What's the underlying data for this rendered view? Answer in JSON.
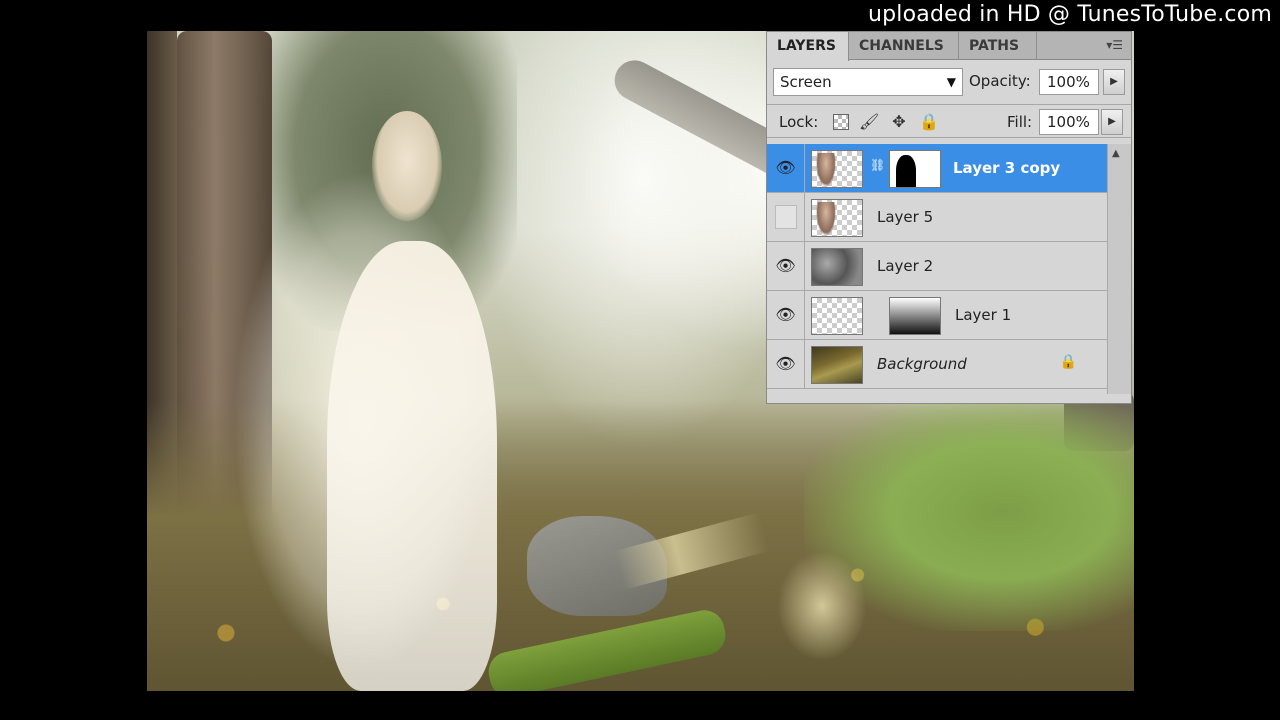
{
  "watermark": "uploaded in HD @ TunesToTube.com",
  "panel": {
    "tabs": [
      {
        "label": "LAYERS",
        "active": true
      },
      {
        "label": "CHANNELS",
        "active": false
      },
      {
        "label": "PATHS",
        "active": false
      }
    ],
    "menu_icon": "panel-menu-icon",
    "blend_mode": "Screen",
    "opacity_label": "Opacity:",
    "opacity_value": "100%",
    "lock_label": "Lock:",
    "fill_label": "Fill:",
    "fill_value": "100%",
    "layers": [
      {
        "name": "Layer 3 copy",
        "visible": true,
        "selected": true,
        "has_mask": true
      },
      {
        "name": "Layer 5",
        "visible": false,
        "selected": false,
        "has_mask": false
      },
      {
        "name": "Layer 2",
        "visible": true,
        "selected": false,
        "has_mask": false
      },
      {
        "name": "Layer 1",
        "visible": true,
        "selected": false,
        "has_mask": true
      },
      {
        "name": "Background",
        "visible": true,
        "selected": false,
        "locked": true
      }
    ]
  },
  "colors": {
    "selection": "#3b8ee6",
    "panel_bg": "#d6d6d6"
  }
}
